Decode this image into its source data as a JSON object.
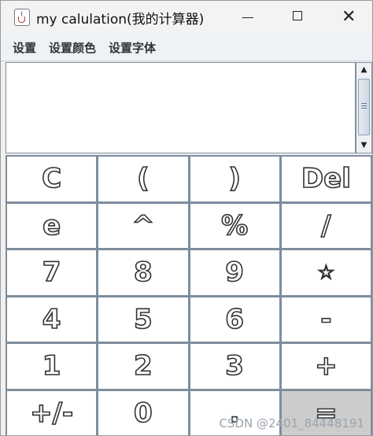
{
  "window": {
    "title": "my calulation(我的计算器)",
    "app_icon": "java-coffee-icon"
  },
  "menu": {
    "items": [
      "设置",
      "设置颜色",
      "设置字体"
    ]
  },
  "display": {
    "value": ""
  },
  "keypad": {
    "keys": [
      "C",
      "(",
      ")",
      "Del",
      "e",
      "^",
      "%",
      "/",
      "7",
      "8",
      "9",
      "☆",
      "4",
      "5",
      "6",
      "-",
      "1",
      "2",
      "3",
      "+",
      "+/-",
      "0",
      ".",
      "="
    ]
  },
  "watermark": "CSDN @2401_84448191",
  "colors": {
    "equals_key_bg": "#cccccc",
    "grid_lines": "#7d8d9d"
  }
}
